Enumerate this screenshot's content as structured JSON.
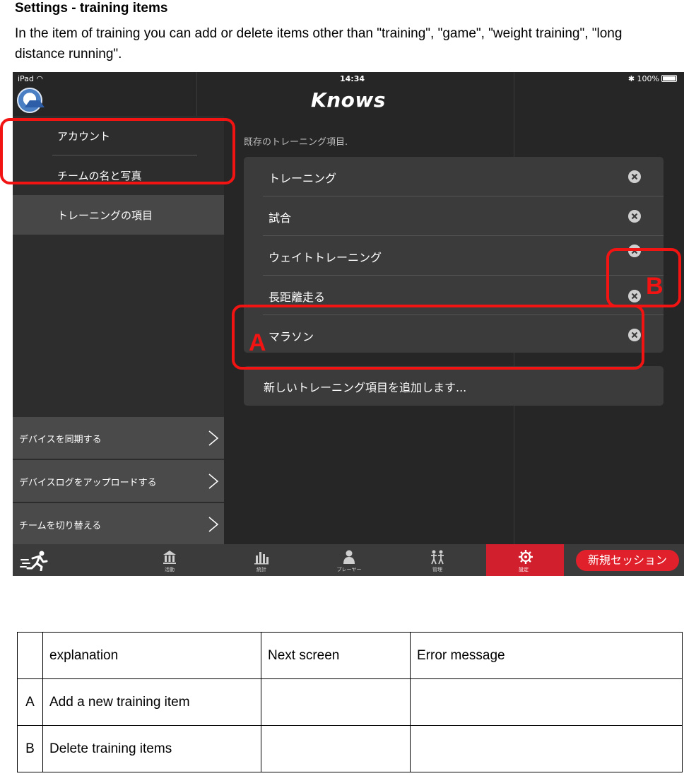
{
  "doc": {
    "title": "Settings - training items",
    "description": "In the item of training you can add or delete items other than \"training\", \"game\", \"weight training\", \"long distance running\"."
  },
  "status_bar": {
    "device": "iPad",
    "time": "14:34",
    "battery": "100%"
  },
  "app": {
    "logo": "Knows",
    "team_logo_icon": "team-crest-icon"
  },
  "sidebar": {
    "menu": [
      {
        "label": "アカウント"
      },
      {
        "label": "チームの名と写真"
      },
      {
        "label": "トレーニングの項目",
        "active": true
      }
    ],
    "actions": [
      {
        "label": "デバイスを同期する"
      },
      {
        "label": "デバイスログをアップロードする"
      },
      {
        "label": "チームを切り替える"
      }
    ]
  },
  "main": {
    "section_title": "既存のトレーニング項目.",
    "items": [
      {
        "label": "トレーニング"
      },
      {
        "label": "試合"
      },
      {
        "label": "ウェイトトレーニング"
      },
      {
        "label": "長距離走る"
      },
      {
        "label": "マラソン"
      }
    ],
    "add_label": "新しいトレーニング項目を追加します..."
  },
  "tabbar": {
    "tabs": [
      {
        "label": "活動",
        "icon": "bank-icon"
      },
      {
        "label": "統計",
        "icon": "bar-chart-icon"
      },
      {
        "label": "プレーヤー",
        "icon": "person-icon"
      },
      {
        "label": "管理",
        "icon": "people-icon"
      },
      {
        "label": "設定",
        "icon": "gear-icon",
        "active": true
      }
    ],
    "new_session": "新規セッション"
  },
  "annotations": {
    "a": "A",
    "b": "B",
    "color": "#f21313"
  },
  "table": {
    "headers": [
      "",
      "explanation",
      "Next screen",
      "Error message"
    ],
    "rows": [
      [
        "A",
        "Add a new training item",
        "",
        ""
      ],
      [
        "B",
        "Delete training items",
        "",
        ""
      ]
    ]
  }
}
